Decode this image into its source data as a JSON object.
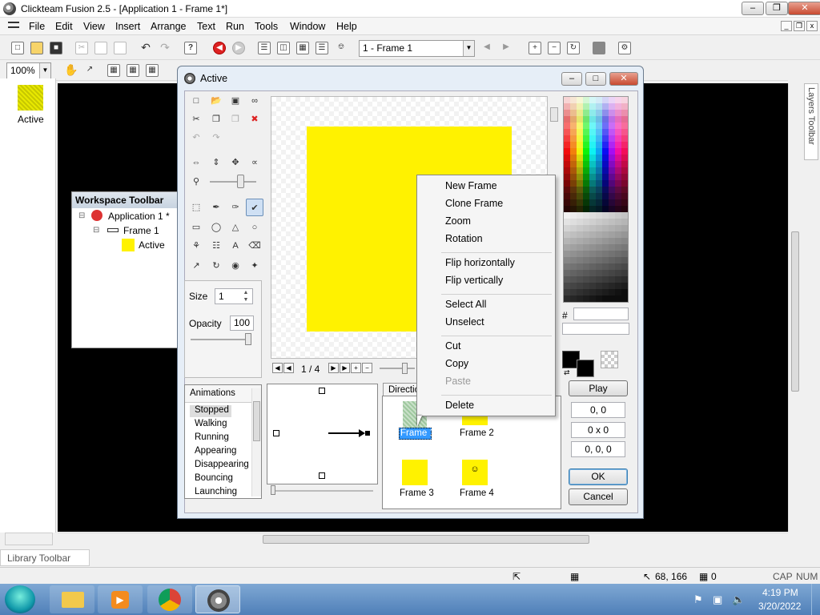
{
  "window": {
    "title": "Clickteam Fusion 2.5 - [Application 1 - Frame 1*]"
  },
  "menu": {
    "items": [
      "File",
      "Edit",
      "View",
      "Insert",
      "Arrange",
      "Text",
      "Run",
      "Tools",
      "Window",
      "Help"
    ]
  },
  "toolbar": {
    "frame_select": "1 - Frame 1",
    "zoom": "100%"
  },
  "left_panel": {
    "object_label": "Active"
  },
  "workspace": {
    "title": "Workspace Toolbar",
    "app": "Application 1 *",
    "frame": "Frame 1",
    "object": "Active"
  },
  "layers_tab": "Layers Toolbar",
  "library_tab": "Library Toolbar",
  "dialog": {
    "title": "Active",
    "size_label": "Size",
    "size_value": "1",
    "opacity_label": "Opacity",
    "opacity_value": "100",
    "frame_counter": "1 / 4",
    "hash_label": "#",
    "play_label": "Play",
    "coord1": "0, 0",
    "coord2": "0 x 0",
    "coord3": "0, 0, 0",
    "ok_label": "OK",
    "cancel_label": "Cancel",
    "direction_tab": "Directio",
    "animations_header": "Animations",
    "animations": [
      "Stopped",
      "Walking",
      "Running",
      "Appearing",
      "Disappearing",
      "Bouncing",
      "Launching"
    ],
    "frames": [
      "Frame 1",
      "Frame 2",
      "Frame 3",
      "Frame 4"
    ]
  },
  "context_menu": {
    "new_frame": "New Frame",
    "clone_frame": "Clone Frame",
    "zoom": "Zoom",
    "rotation": "Rotation",
    "flip_h": "Flip horizontally",
    "flip_v": "Flip vertically",
    "select_all": "Select All",
    "unselect": "Unselect",
    "cut": "Cut",
    "copy": "Copy",
    "paste": "Paste",
    "delete": "Delete"
  },
  "status": {
    "coords": "68, 166",
    "zero": "0",
    "cap": "CAP",
    "num": "NUM"
  },
  "taskbar": {
    "time": "4:19 PM",
    "date": "3/20/2022"
  },
  "colors": {
    "yellow": "#fff200",
    "selection": "#3399ff",
    "dialog_bg": "#e6eef7"
  }
}
